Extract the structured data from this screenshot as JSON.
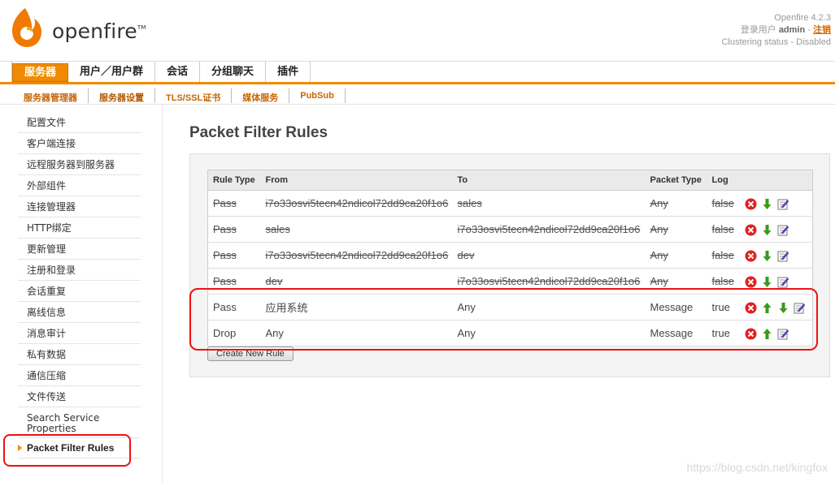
{
  "header": {
    "brand": "openfire",
    "tm": "TM",
    "version": "Openfire 4.2.3",
    "login_prefix": "登录用户 ",
    "user": "admin",
    "separator": " - ",
    "logout": "注销",
    "clustering": "Clustering status - Disabled"
  },
  "main_nav": [
    "服务器",
    "用户／用户群",
    "会话",
    "分组聊天",
    "插件"
  ],
  "sub_nav": [
    "服务器管理器",
    "服务器设置",
    "TLS/SSL证书",
    "媒体服务",
    "PubSub"
  ],
  "sidebar": [
    "配置文件",
    "客户端连接",
    "远程服务器到服务器",
    "外部组件",
    "连接管理器",
    "HTTP绑定",
    "更新管理",
    "注册和登录",
    "会话重复",
    "离线信息",
    "消息审计",
    "私有数据",
    "通信压缩",
    "文件传送",
    "Search Service Properties",
    "Packet Filter Rules"
  ],
  "page_title": "Packet Filter Rules",
  "table": {
    "headers": [
      "Rule Type",
      "From",
      "To",
      "Packet Type",
      "Log"
    ],
    "rows": [
      {
        "type": "Pass",
        "from": "i7o33osvi5tecn42ndicol72dd9ca20f1o6",
        "to": "sales",
        "packet": "Any",
        "log": "false",
        "disabled": true
      },
      {
        "type": "Pass",
        "from": "sales",
        "to": "i7o33osvi5tecn42ndicol72dd9ca20f1o6",
        "packet": "Any",
        "log": "false",
        "disabled": true
      },
      {
        "type": "Pass",
        "from": "i7o33osvi5tecn42ndicol72dd9ca20f1o6",
        "to": "dev",
        "packet": "Any",
        "log": "false",
        "disabled": true
      },
      {
        "type": "Pass",
        "from": "dev",
        "to": "i7o33osvi5tecn42ndicol72dd9ca20f1o6",
        "packet": "Any",
        "log": "false",
        "disabled": true
      },
      {
        "type": "Pass",
        "from": "应用系统",
        "to": "Any",
        "packet": "Message",
        "log": "true",
        "disabled": false
      },
      {
        "type": "Drop",
        "from": "Any",
        "to": "Any",
        "packet": "Message",
        "log": "true",
        "disabled": false
      }
    ]
  },
  "create_button": "Create New Rule",
  "watermark": "https://blog.csdn.net/kingfox",
  "colors": {
    "accent": "#f08a00",
    "highlight": "#e11111",
    "delete": "#e02020",
    "arrow": "#3a9a1a"
  }
}
